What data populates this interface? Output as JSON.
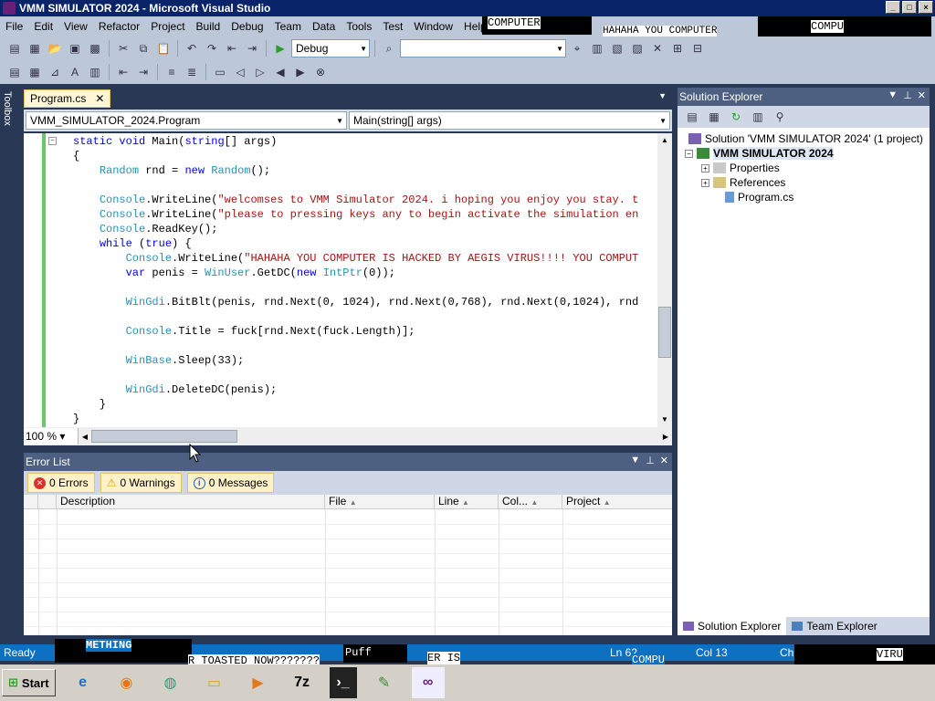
{
  "window": {
    "title": "VMM SIMULATOR 2024 - Microsoft Visual Studio"
  },
  "menu": [
    "File",
    "Edit",
    "View",
    "Refactor",
    "Project",
    "Build",
    "Debug",
    "Team",
    "Data",
    "Tools",
    "Test",
    "Window",
    "Help"
  ],
  "toolbar": {
    "config": "Debug"
  },
  "toolbox": {
    "label": "Toolbox"
  },
  "editor": {
    "tab": "Program.cs",
    "nav_class": "VMM_SIMULATOR_2024.Program",
    "nav_member": "Main(string[] args)",
    "zoom": "100 %",
    "lines": [
      "static void Main(string[] args)",
      "{",
      "    Random rnd = new Random();",
      "",
      "    Console.WriteLine(\"welcomses to VMM Simulator 2024. i hoping you enjoy you stay. t",
      "    Console.WriteLine(\"please to pressing keys any to begin activate the simulation en",
      "    Console.ReadKey();",
      "    while (true) {",
      "        Console.WriteLine(\"HAHAHA YOU COMPUTER IS HACKED BY AEGIS VIRUS!!!! YOU COMPUT",
      "        var penis = WinUser.GetDC(new IntPtr(0));",
      "",
      "        WinGdi.BitBlt(penis, rnd.Next(0, 1024), rnd.Next(0,768), rnd.Next(0,1024), rnd",
      "",
      "        Console.Title = fuck[rnd.Next(fuck.Length)];",
      "",
      "        WinBase.Sleep(33);",
      "",
      "        WinGdi.DeleteDC(penis);",
      "    }",
      "}"
    ]
  },
  "error_list": {
    "title": "Error List",
    "errors": "0 Errors",
    "warnings": "0 Warnings",
    "messages": "0 Messages",
    "columns": [
      "Description",
      "File",
      "Line",
      "Col...",
      "Project"
    ]
  },
  "solution_explorer": {
    "title": "Solution Explorer",
    "solution": "Solution 'VMM SIMULATOR 2024' (1 project)",
    "project": "VMM SIMULATOR 2024",
    "items": [
      "Properties",
      "References",
      "Program.cs"
    ],
    "tabs": [
      "Solution Explorer",
      "Team Explorer"
    ]
  },
  "status": {
    "state": "Ready",
    "ln": "Ln 62",
    "col": "Col 13",
    "ch": "Ch 13"
  },
  "taskbar": {
    "start": "Start",
    "seven_zip": "7z"
  },
  "glitch": {
    "t1": "COMPUTER",
    "t2": "HAHAHA YOU COMPUTER",
    "t3": "COMPU",
    "t4": "METHING",
    "t5": "R TOASTED NOW???????",
    "t6": "Puff",
    "t7": "ER IS",
    "t8": "COMPU",
    "t9": "VIRU"
  }
}
